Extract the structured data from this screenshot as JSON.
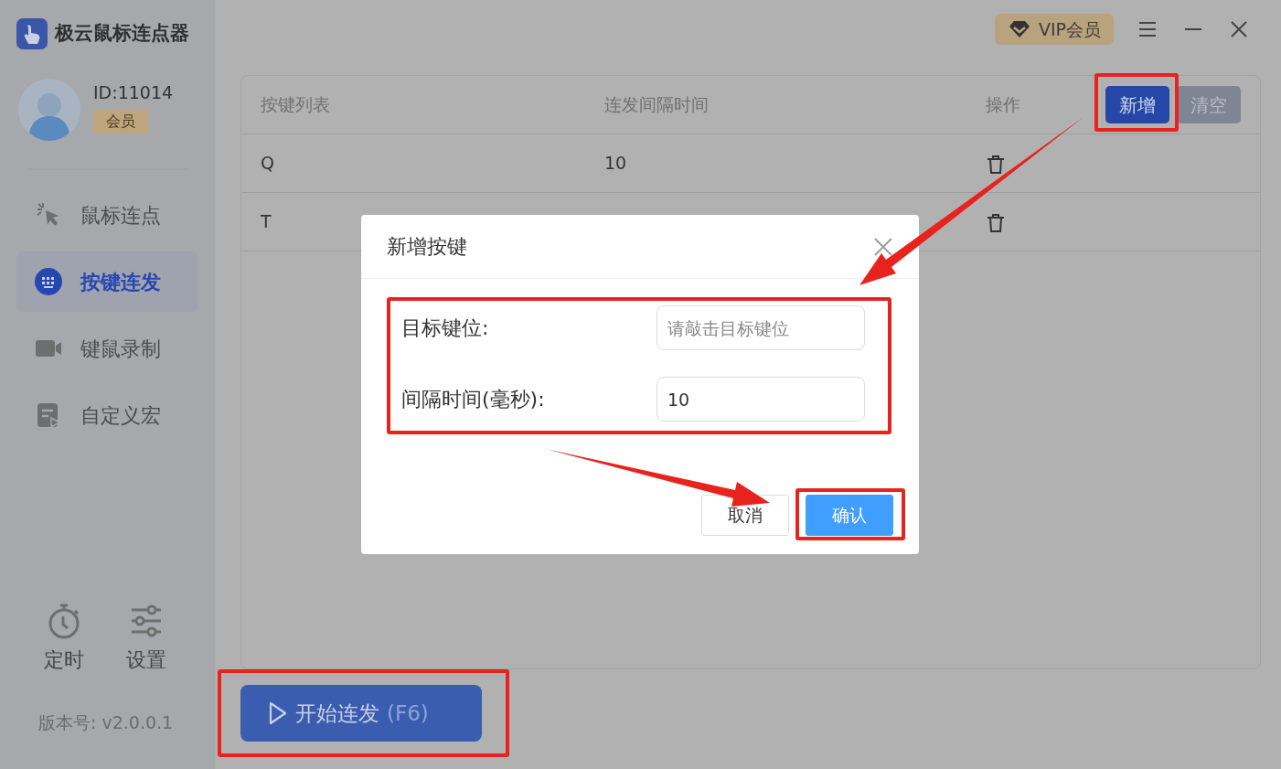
{
  "app": {
    "title": "极云鼠标连点器"
  },
  "user": {
    "id": "ID:11014",
    "badge": "会员"
  },
  "nav": [
    {
      "label": "鼠标连点",
      "kind": "cursor",
      "selected": false
    },
    {
      "label": "按键连发",
      "kind": "keyboard",
      "selected": true
    },
    {
      "label": "键鼠录制",
      "kind": "camera",
      "selected": false
    },
    {
      "label": "自定义宏",
      "kind": "macro",
      "selected": false
    }
  ],
  "tools": [
    {
      "label": "定时",
      "kind": "timer"
    },
    {
      "label": "设置",
      "kind": "sliders"
    }
  ],
  "version": "版本号: v2.0.0.1",
  "header": {
    "vip": "VIP会员"
  },
  "table": {
    "columns": [
      "按键列表",
      "连发间隔时间",
      "操作"
    ],
    "buttons": [
      {
        "label": "新增",
        "kind": "primary"
      },
      {
        "label": "清空",
        "kind": "secondary"
      }
    ],
    "rows": [
      {
        "key": "Q",
        "interval": "10"
      },
      {
        "key": "T"
      }
    ]
  },
  "start_button": {
    "label": "开始连发",
    "hotkey": "(F6)"
  },
  "dialog": {
    "title": "新增按键",
    "fields": [
      {
        "label": "目标键位:",
        "placeholder": "请敲击目标键位"
      },
      {
        "label": "间隔时间(毫秒):",
        "value": "10"
      }
    ],
    "buttons": [
      {
        "label": "取消",
        "kind": "default"
      },
      {
        "label": "确认",
        "kind": "primary"
      }
    ]
  }
}
